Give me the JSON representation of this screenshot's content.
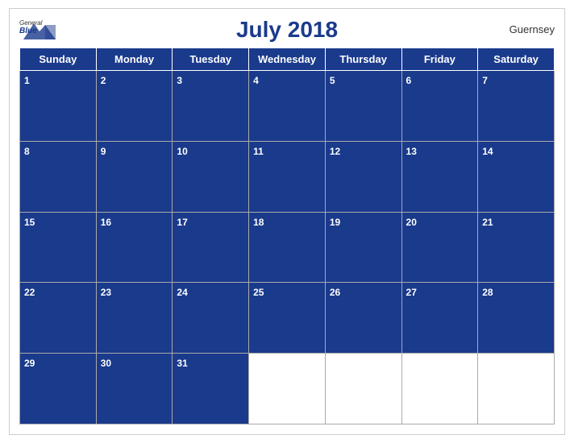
{
  "header": {
    "logo_general": "General",
    "logo_blue": "Blue",
    "title": "July 2018",
    "region": "Guernsey"
  },
  "days_of_week": [
    "Sunday",
    "Monday",
    "Tuesday",
    "Wednesday",
    "Thursday",
    "Friday",
    "Saturday"
  ],
  "weeks": [
    [
      {
        "num": "1",
        "blue": true
      },
      {
        "num": "2",
        "blue": true
      },
      {
        "num": "3",
        "blue": true
      },
      {
        "num": "4",
        "blue": true
      },
      {
        "num": "5",
        "blue": true
      },
      {
        "num": "6",
        "blue": true
      },
      {
        "num": "7",
        "blue": true
      }
    ],
    [
      {
        "num": "8",
        "blue": true
      },
      {
        "num": "9",
        "blue": true
      },
      {
        "num": "10",
        "blue": true
      },
      {
        "num": "11",
        "blue": true
      },
      {
        "num": "12",
        "blue": true
      },
      {
        "num": "13",
        "blue": true
      },
      {
        "num": "14",
        "blue": true
      }
    ],
    [
      {
        "num": "15",
        "blue": true
      },
      {
        "num": "16",
        "blue": true
      },
      {
        "num": "17",
        "blue": true
      },
      {
        "num": "18",
        "blue": true
      },
      {
        "num": "19",
        "blue": true
      },
      {
        "num": "20",
        "blue": true
      },
      {
        "num": "21",
        "blue": true
      }
    ],
    [
      {
        "num": "22",
        "blue": true
      },
      {
        "num": "23",
        "blue": true
      },
      {
        "num": "24",
        "blue": true
      },
      {
        "num": "25",
        "blue": true
      },
      {
        "num": "26",
        "blue": true
      },
      {
        "num": "27",
        "blue": true
      },
      {
        "num": "28",
        "blue": true
      }
    ],
    [
      {
        "num": "29",
        "blue": true
      },
      {
        "num": "30",
        "blue": true
      },
      {
        "num": "31",
        "blue": true
      },
      {
        "num": "",
        "blue": false
      },
      {
        "num": "",
        "blue": false
      },
      {
        "num": "",
        "blue": false
      },
      {
        "num": "",
        "blue": false
      }
    ]
  ],
  "accent_color": "#1a3a8c"
}
